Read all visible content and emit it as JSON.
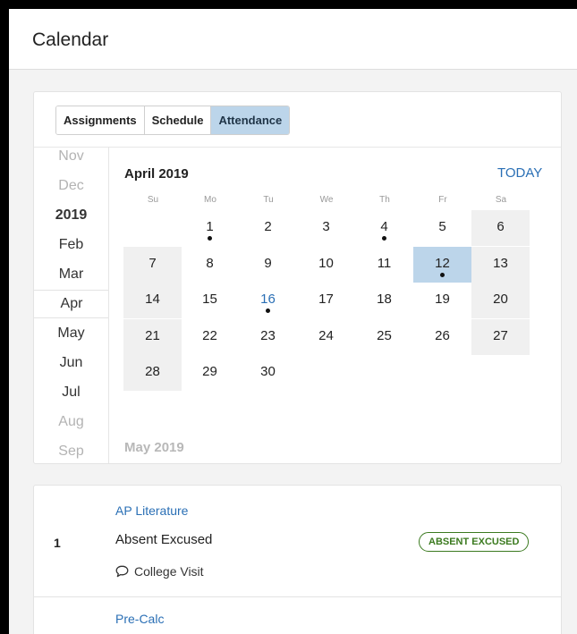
{
  "page": {
    "title": "Calendar"
  },
  "tabs": [
    {
      "label": "Assignments",
      "active": false
    },
    {
      "label": "Schedule",
      "active": false
    },
    {
      "label": "Attendance",
      "active": true
    }
  ],
  "months": [
    {
      "label": "Nov",
      "kind": "dim"
    },
    {
      "label": "Dec",
      "kind": "dim"
    },
    {
      "label": "2019",
      "kind": "year"
    },
    {
      "label": "Feb",
      "kind": "normal"
    },
    {
      "label": "Mar",
      "kind": "normal"
    },
    {
      "label": "Apr",
      "kind": "active"
    },
    {
      "label": "May",
      "kind": "normal"
    },
    {
      "label": "Jun",
      "kind": "normal"
    },
    {
      "label": "Jul",
      "kind": "normal"
    },
    {
      "label": "Aug",
      "kind": "dim"
    },
    {
      "label": "Sep",
      "kind": "dim"
    }
  ],
  "calendar": {
    "title": "April 2019",
    "today_label": "TODAY",
    "weekdays": [
      "Su",
      "Mo",
      "Tu",
      "We",
      "Th",
      "Fr",
      "Sa"
    ],
    "weeks": [
      [
        null,
        1,
        2,
        3,
        4,
        5,
        6
      ],
      [
        7,
        8,
        9,
        10,
        11,
        12,
        13
      ],
      [
        14,
        15,
        16,
        17,
        18,
        19,
        20
      ],
      [
        21,
        22,
        23,
        24,
        25,
        26,
        27
      ],
      [
        28,
        29,
        30,
        null,
        null,
        null,
        null
      ]
    ],
    "event_days": [
      1,
      4,
      12,
      16
    ],
    "selected_day": 12,
    "today": 16,
    "next_month_title": "May 2019"
  },
  "attendance": {
    "entries": [
      {
        "period": "1",
        "course": "AP Literature",
        "status": "Absent Excused",
        "badge": "ABSENT EXCUSED",
        "comment": "College Visit"
      }
    ],
    "next_course": "Pre-Calc"
  },
  "colors": {
    "accent": "#2a6fb5",
    "selected_fill": "#bcd5ea",
    "badge_green": "#3b7a1f"
  }
}
